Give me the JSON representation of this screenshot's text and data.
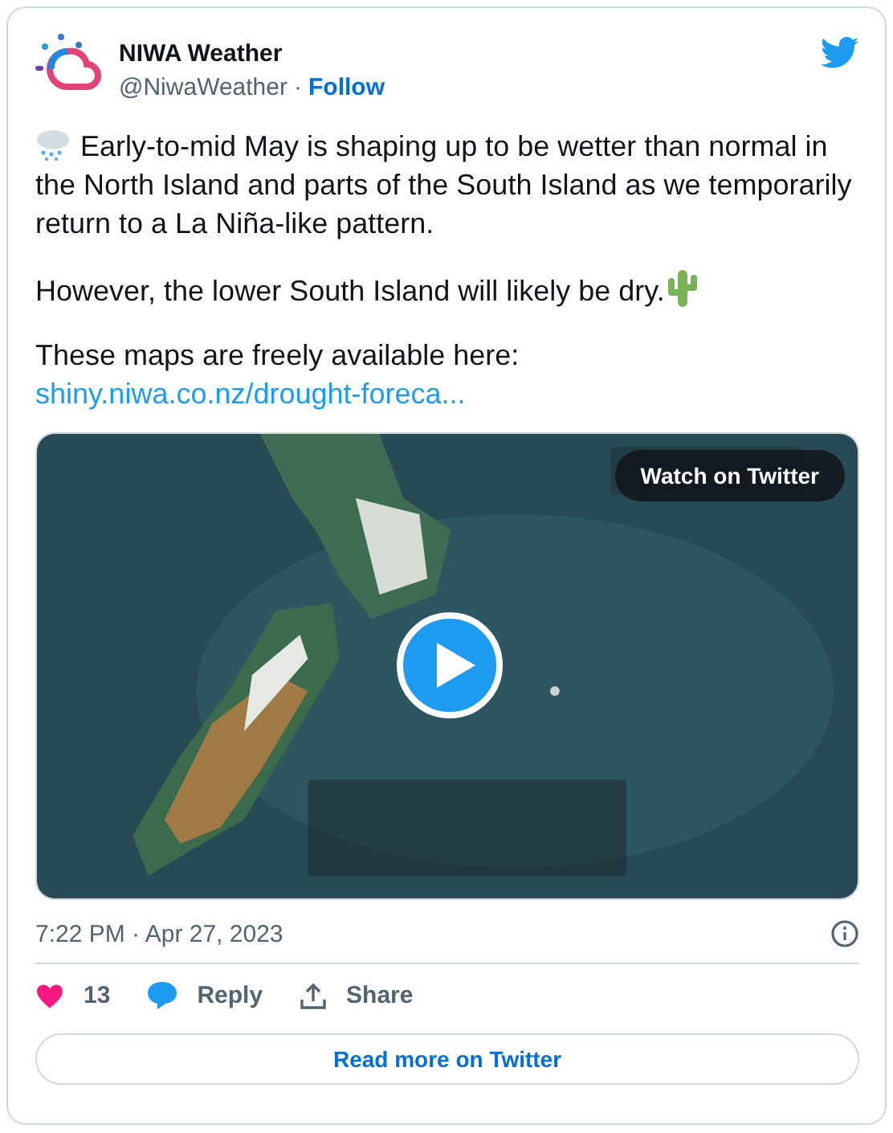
{
  "author": {
    "name": "NIWA Weather",
    "handle": "@NiwaWeather",
    "separator": "·",
    "follow": "Follow"
  },
  "paragraphs": [
    {
      "text": "Early-to-mid May is shaping up to be wetter than normal in the North Island and parts of the South Island as we temporarily return to a La Niña-like pattern.",
      "kind": "rain_lead"
    },
    {
      "text": "However, the lower South Island will likely be dry.",
      "kind": "cactus_trail"
    },
    {
      "text": "These maps are freely available here:",
      "kind": "link",
      "link": "shiny.niwa.co.nz/drought-foreca..."
    }
  ],
  "media": {
    "kind": "picture",
    "overlay_button": "Watch on Twitter"
  },
  "timestamp": "7:22 PM · Apr 27, 2023",
  "actions": [
    {
      "kind": "like",
      "label": "13"
    },
    {
      "kind": "reply",
      "label": "Reply"
    },
    {
      "kind": "share",
      "label": "Share"
    }
  ],
  "read_more": "Read more on Twitter"
}
